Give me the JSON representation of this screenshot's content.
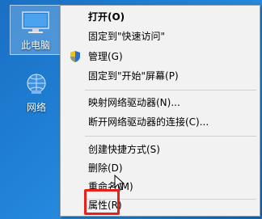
{
  "desktop": {
    "icons": [
      {
        "label": "此电脑",
        "icon": "this-pc-icon"
      },
      {
        "label": "网络",
        "icon": "network-icon"
      }
    ]
  },
  "context_menu": {
    "items": [
      {
        "label": "打开(O)",
        "bold": true
      },
      {
        "label": "固定到\"快速访问\""
      },
      {
        "label": "管理(G)",
        "icon": "shield-icon"
      },
      {
        "label": "固定到\"开始\"屏幕(P)"
      },
      {
        "label": "映射网络驱动器(N)..."
      },
      {
        "label": "断开网络驱动器的连接(C)..."
      },
      {
        "label": "创建快捷方式(S)"
      },
      {
        "label": "删除(D)"
      },
      {
        "label": "重命名(M)"
      },
      {
        "label": "属性(R)"
      }
    ]
  },
  "highlight": {
    "color": "#e8201a",
    "target": "属性(R)"
  },
  "cursor": {
    "icon": "mouse-pointer-icon"
  }
}
